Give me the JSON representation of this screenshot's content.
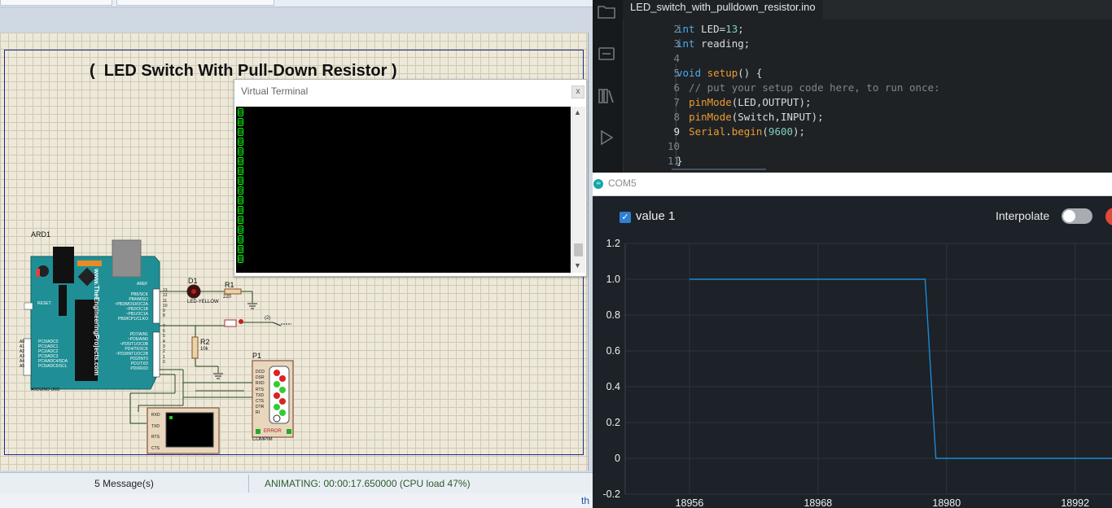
{
  "proteus": {
    "schematic_title": "(  LED Switch With Pull-Down Resistor )",
    "virtual_terminal": {
      "title": "Virtual Terminal",
      "close_label": "x",
      "lines": [
        "0",
        "0",
        "0",
        "0",
        "0",
        "0",
        "0",
        "0",
        "0",
        "0",
        "0",
        "0",
        "0",
        "0",
        "0",
        "0"
      ]
    },
    "components": {
      "arduino_ref": "ARD1",
      "arduino_name": "ARDUINO UNO",
      "arduino_brand": "www.TheEngineeringProjects.com",
      "arduino_reset": "RESET",
      "arduino_aref": "AREF",
      "arduino_pins_right_top": [
        "PB5/SCK",
        "PB4/MISO",
        "~PB3/MOSI/OC2A",
        "~PB2/OC1B",
        "~PB1/OC1A",
        "PB0/ICP1/CLKO"
      ],
      "arduino_pins_right_bottom": [
        "PD7/AIN1",
        "~PD6/AIN0",
        "~PD5/T1/OC0B",
        "PD4/T0/XCK",
        "~PD3/INT1/OC2B",
        "PD2/INT0",
        "PD1/TXD",
        "PD0/RXD"
      ],
      "arduino_pins_left": [
        "PC0/ADC0",
        "PC1/ADC1",
        "PC2/ADC2",
        "PC3/ADC3",
        "PC4/ADC4/SDA",
        "PC5/ADC5/SCL"
      ],
      "arduino_analog_labels": [
        "A0",
        "A1",
        "A2",
        "A3",
        "A4",
        "A5"
      ],
      "arduino_pin_numbers": [
        "13",
        "12",
        "11",
        "10",
        "9",
        "8",
        "7",
        "6",
        "5",
        "4",
        "3",
        "2",
        "1",
        "0"
      ],
      "led_ref": "D1",
      "led_value": "LED-YELLOW",
      "r1_ref": "R1",
      "r1_value": "220",
      "r2_ref": "R2",
      "r2_value": "10k",
      "port_ref": "P1",
      "port_name": "COMPIM",
      "port_signals": [
        "DCD",
        "DSR",
        "RXD",
        "RTS",
        "TXD",
        "CTS",
        "DTR",
        "RI"
      ],
      "port_error": "ERROR",
      "terminal_pins": [
        "RXD",
        "TXD",
        "RTS",
        "CTS"
      ],
      "switch_mark": "(2)"
    },
    "status": {
      "messages": "5 Message(s)",
      "animating": "ANIMATING: 00:00:17.650000 (CPU load 47%)",
      "bottom_right": "th"
    }
  },
  "ide": {
    "tab_label": "LED_switch_with_pulldown_resistor.ino",
    "sidebar_icons": [
      "folder-icon",
      "board-icon",
      "library-icon",
      "debug-icon"
    ],
    "code_lines": [
      {
        "n": "2",
        "text": "int LED=13;"
      },
      {
        "n": "3",
        "text": "int reading;"
      },
      {
        "n": "4",
        "text": ""
      },
      {
        "n": "5",
        "text": "void setup() {"
      },
      {
        "n": "6",
        "text": "  // put your setup code here, to run once:"
      },
      {
        "n": "7",
        "text": "  pinMode(LED,OUTPUT);"
      },
      {
        "n": "8",
        "text": "  pinMode(Switch,INPUT);"
      },
      {
        "n": "9",
        "text": "  Serial.begin(9600);"
      },
      {
        "n": "10",
        "text": ""
      },
      {
        "n": "11",
        "text": "}"
      }
    ],
    "current_line": "9"
  },
  "plotter": {
    "title": "COM5",
    "legend_label": "value 1",
    "legend_checked": true,
    "interpolate_label": "Interpolate",
    "interpolate_on": false
  },
  "chart_data": {
    "type": "line",
    "xlim": [
      18950,
      19000
    ],
    "ylim": [
      -0.2,
      1.2
    ],
    "x_ticks": [
      18956,
      18968,
      18980,
      18992
    ],
    "y_ticks": [
      1.2,
      1.0,
      0.8,
      0.6,
      0.4,
      0.2,
      0,
      -0.2
    ],
    "y_tick_labels": [
      "1.2",
      "1.0",
      "0.8",
      "0.6",
      "0.4",
      "0.2",
      "0",
      "-0.2"
    ],
    "series": [
      {
        "name": "value 1",
        "color": "#1e88d6",
        "x": [
          18956,
          18978,
          18979,
          18996
        ],
        "y": [
          1,
          1,
          0,
          0
        ]
      }
    ],
    "grid": true
  },
  "colors": {
    "ide_bg": "#1e2225",
    "plot_bg": "#1c2227",
    "accent_teal": "#13a7a5",
    "terminal_text": "#10ff10",
    "arduino_board": "#1f8f95"
  }
}
